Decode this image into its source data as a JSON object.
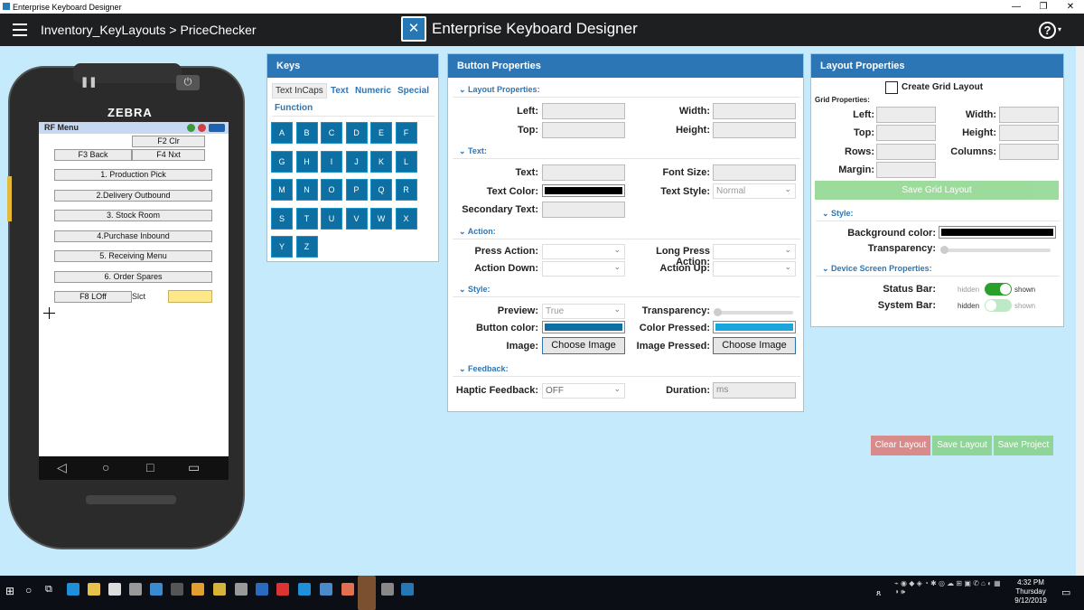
{
  "window": {
    "title": "Enterprise Keyboard Designer",
    "controls": [
      "—",
      "❐",
      "✕"
    ]
  },
  "header": {
    "breadcrumb": "Inventory_KeyLayouts > PriceChecker",
    "app_title": "Enterprise Keyboard Designer",
    "help": "?"
  },
  "device": {
    "brand": "ZEBRA",
    "screen_title": "RF Menu",
    "buttons": [
      "F2 Clr",
      "F3 Back",
      "F4 Nxt",
      "1. Production Pick",
      "2.Delivery Outbound",
      "3. Stock Room",
      "4.Purchase Inbound",
      "5. Receiving Menu",
      "6. Order Spares",
      "F8 LOff"
    ],
    "slct_label": "Slct"
  },
  "keys_panel": {
    "title": "Keys",
    "tabs": [
      "Text InCaps",
      "Text",
      "Numeric",
      "Special",
      "Function"
    ],
    "active_tab": "Text InCaps",
    "keys": [
      "A",
      "B",
      "C",
      "D",
      "E",
      "F",
      "G",
      "H",
      "I",
      "J",
      "K",
      "L",
      "M",
      "N",
      "O",
      "P",
      "Q",
      "R",
      "S",
      "T",
      "U",
      "V",
      "W",
      "X",
      "Y",
      "Z"
    ]
  },
  "button_props": {
    "title": "Button Properties",
    "sections": {
      "layout": "Layout Properties:",
      "text": "Text:",
      "action": "Action:",
      "style": "Style:",
      "feedback": "Feedback:"
    },
    "labels": {
      "left": "Left:",
      "width": "Width:",
      "top": "Top:",
      "height": "Height:",
      "text": "Text:",
      "font_size": "Font Size:",
      "text_color": "Text Color:",
      "text_style": "Text Style:",
      "secondary_text": "Secondary Text:",
      "press_action": "Press Action:",
      "long_press_action": "Long Press Action:",
      "action_down": "Action Down:",
      "action_up": "Action Up:",
      "preview": "Preview:",
      "transparency": "Transparency:",
      "button_color": "Button color:",
      "color_pressed": "Color Pressed:",
      "image": "Image:",
      "image_pressed": "Image Pressed:",
      "haptic": "Haptic Feedback:",
      "duration": "Duration:"
    },
    "text_style_value": "Normal",
    "preview_value": "True",
    "haptic_value": "OFF",
    "duration_placeholder": "ms",
    "choose_image": "Choose Image",
    "colors": {
      "text_color": "#000000",
      "button_color": "#0e6fa3",
      "color_pressed": "#1aa5dc"
    }
  },
  "layout_props": {
    "title": "Layout Properties",
    "create_grid": "Create Grid Layout",
    "grid_properties": "Grid Properties:",
    "labels": {
      "left": "Left:",
      "width": "Width:",
      "top": "Top:",
      "height": "Height:",
      "rows": "Rows:",
      "columns": "Columns:",
      "margin": "Margin:"
    },
    "save_grid": "Save Grid Layout",
    "style_section": "Style:",
    "background_color": "Background color:",
    "transparency": "Transparency:",
    "device_screen_section": "Device Screen Properties:",
    "status_bar": "Status Bar:",
    "system_bar": "System Bar:",
    "hidden": "hidden",
    "shown": "shown",
    "status_bar_shown": true,
    "system_bar_shown": false
  },
  "actions": {
    "clear": "Clear Layout",
    "save_layout": "Save Layout",
    "save_project": "Save Project"
  },
  "taskbar": {
    "time": "4:32 PM",
    "day": "Thursday",
    "date": "9/12/2019"
  }
}
